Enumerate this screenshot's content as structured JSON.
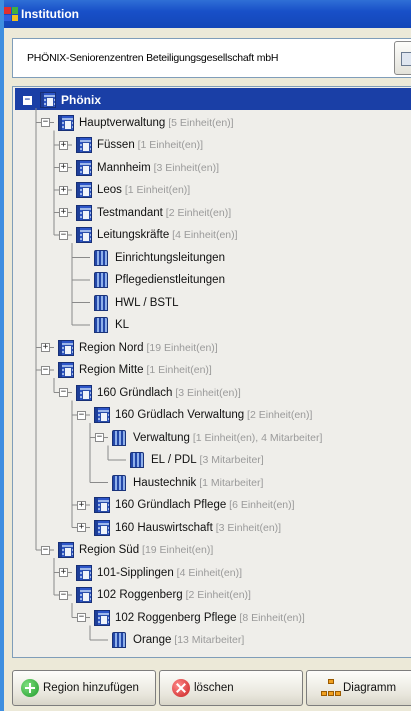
{
  "window": {
    "title": "Institution"
  },
  "header": {
    "company_name": "PHÖNIX-Seniorenzentren Beteiligungsgesellschaft mbH"
  },
  "tree": {
    "nodes": [
      {
        "label": "Phönix",
        "count": "",
        "depth": 0,
        "toggle": "−",
        "icon": "building"
      },
      {
        "label": "Hauptverwaltung",
        "count": "[5 Einheit(en)]",
        "depth": 1,
        "toggle": "−",
        "icon": "building"
      },
      {
        "label": "Füssen",
        "count": "[1 Einheit(en)]",
        "depth": 2,
        "toggle": "+",
        "icon": "building"
      },
      {
        "label": "Mannheim",
        "count": "[3 Einheit(en)]",
        "depth": 2,
        "toggle": "+",
        "icon": "building"
      },
      {
        "label": "Leos",
        "count": "[1 Einheit(en)]",
        "depth": 2,
        "toggle": "+",
        "icon": "building"
      },
      {
        "label": "Testmandant",
        "count": "[2 Einheit(en)]",
        "depth": 2,
        "toggle": "+",
        "icon": "building"
      },
      {
        "label": "Leitungskräfte",
        "count": "[4 Einheit(en)]",
        "depth": 2,
        "toggle": "−",
        "icon": "building"
      },
      {
        "label": "Einrichtungsleitungen",
        "count": "",
        "depth": 3,
        "toggle": "",
        "icon": "unit"
      },
      {
        "label": "Pflegedienstleitungen",
        "count": "",
        "depth": 3,
        "toggle": "",
        "icon": "unit"
      },
      {
        "label": "HWL / BSTL",
        "count": "",
        "depth": 3,
        "toggle": "",
        "icon": "unit"
      },
      {
        "label": "KL",
        "count": "",
        "depth": 3,
        "toggle": "",
        "icon": "unit"
      },
      {
        "label": "Region Nord",
        "count": "[19 Einheit(en)]",
        "depth": 1,
        "toggle": "+",
        "icon": "building"
      },
      {
        "label": "Region Mitte",
        "count": "[1 Einheit(en)]",
        "depth": 1,
        "toggle": "−",
        "icon": "building"
      },
      {
        "label": "160 Gründlach",
        "count": "[3 Einheit(en)]",
        "depth": 2,
        "toggle": "−",
        "icon": "building"
      },
      {
        "label": "160 Grüdlach Verwaltung",
        "count": "[2 Einheit(en)]",
        "depth": 3,
        "toggle": "−",
        "icon": "building"
      },
      {
        "label": "Verwaltung",
        "count": "[1 Einheit(en), 4 Mitarbeiter]",
        "depth": 4,
        "toggle": "−",
        "icon": "unit"
      },
      {
        "label": "EL / PDL",
        "count": "[3 Mitarbeiter]",
        "depth": 5,
        "toggle": "",
        "icon": "unit"
      },
      {
        "label": "Haustechnik",
        "count": "[1 Mitarbeiter]",
        "depth": 4,
        "toggle": "",
        "icon": "unit"
      },
      {
        "label": "160 Gründlach Pflege",
        "count": "[6 Einheit(en)]",
        "depth": 3,
        "toggle": "+",
        "icon": "building"
      },
      {
        "label": "160 Hauswirtschaft",
        "count": "[3 Einheit(en)]",
        "depth": 3,
        "toggle": "+",
        "icon": "building"
      },
      {
        "label": "Region Süd",
        "count": "[19 Einheit(en)]",
        "depth": 1,
        "toggle": "−",
        "icon": "building"
      },
      {
        "label": "101-Sipplingen",
        "count": "[4 Einheit(en)]",
        "depth": 2,
        "toggle": "+",
        "icon": "building"
      },
      {
        "label": "102 Roggenberg",
        "count": "[2 Einheit(en)]",
        "depth": 2,
        "toggle": "−",
        "icon": "building"
      },
      {
        "label": "102 Roggenberg Pflege",
        "count": "[8 Einheit(en)]",
        "depth": 3,
        "toggle": "−",
        "icon": "building"
      },
      {
        "label": "Orange",
        "count": "[13 Mitarbeiter]",
        "depth": 4,
        "toggle": "",
        "icon": "unit"
      }
    ]
  },
  "footer": {
    "add_label": "Region hinzufügen",
    "delete_label": "löschen",
    "diagram_label": "Diagramm"
  }
}
